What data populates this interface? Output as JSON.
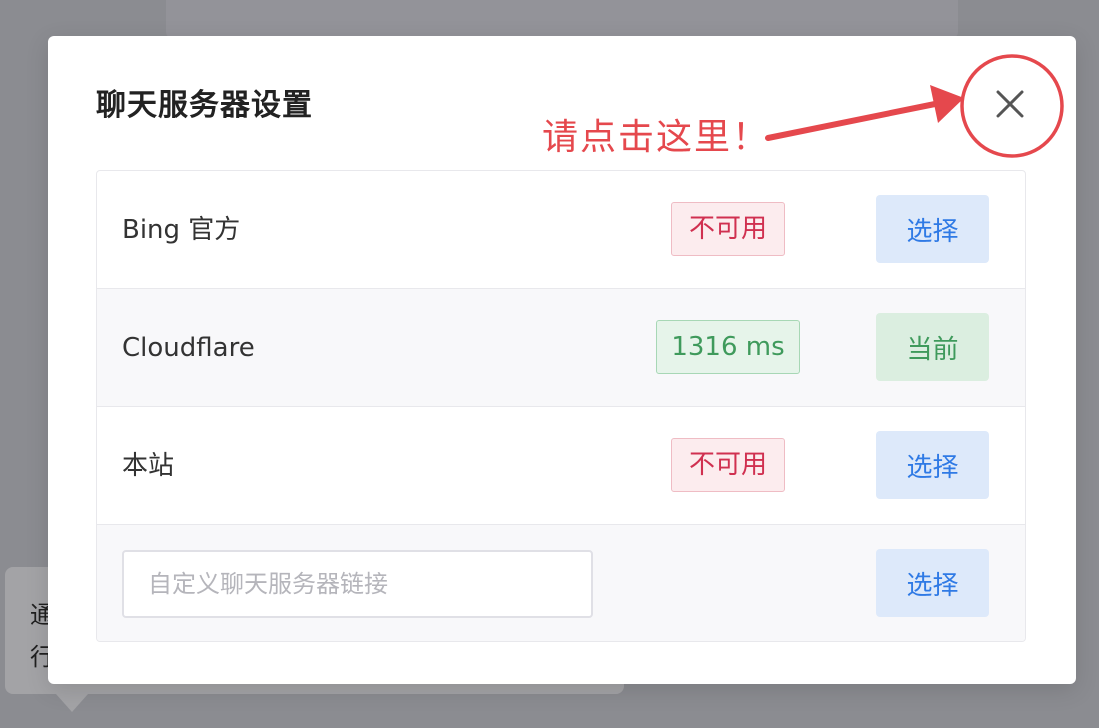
{
  "background": {
    "tooltip_text": "通\n行"
  },
  "modal": {
    "title": "聊天服务器设置",
    "annotation": "请点击这里！",
    "colors": {
      "annotation": "#e5484d",
      "unavailable": "#d03050",
      "ok": "#3f9a5c",
      "select": "#2f7ae5"
    }
  },
  "servers": [
    {
      "name": "Bing 官方",
      "status": "不可用",
      "status_type": "unavailable",
      "action": "选择",
      "action_type": "select"
    },
    {
      "name": "Cloudflare",
      "status": "1316 ms",
      "status_type": "ok",
      "action": "当前",
      "action_type": "current"
    },
    {
      "name": "本站",
      "status": "不可用",
      "status_type": "unavailable",
      "action": "选择",
      "action_type": "select"
    }
  ],
  "custom": {
    "value": "",
    "placeholder": "自定义聊天服务器链接",
    "action": "选择"
  }
}
